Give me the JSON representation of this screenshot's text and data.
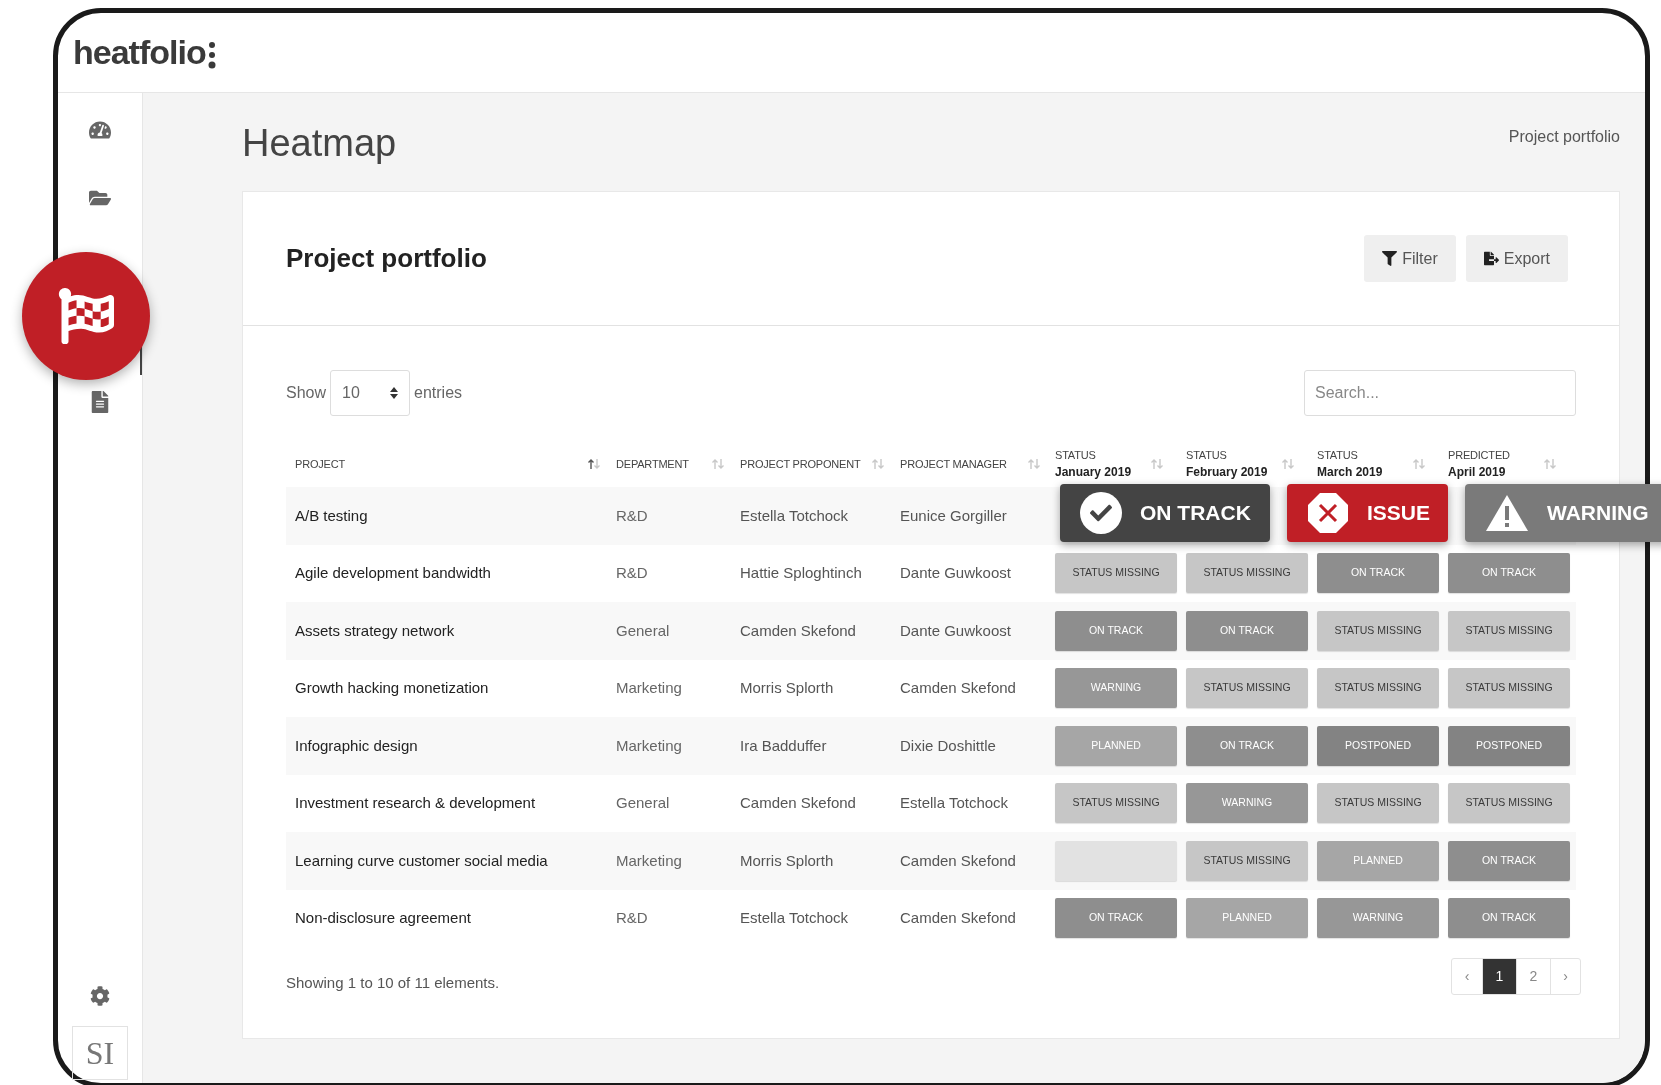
{
  "header": {
    "logo": "heatfolio"
  },
  "sidebar": {
    "items": [
      {
        "kind": "dashboard",
        "selected": false
      },
      {
        "kind": "folder",
        "selected": false
      },
      {
        "kind": "flag",
        "selected": true
      },
      {
        "kind": "document",
        "selected": false
      }
    ],
    "avatar": "SI"
  },
  "page": {
    "title": "Heatmap",
    "breadcrumb": "Project portfolio"
  },
  "card": {
    "title": "Project portfolio",
    "actions": [
      {
        "kind": "filter",
        "label": "Filter"
      },
      {
        "kind": "export",
        "label": "Export"
      }
    ]
  },
  "length_control": {
    "before": "Show",
    "value": "10",
    "after": "entries"
  },
  "search": {
    "placeholder": "Search..."
  },
  "table": {
    "columns": [
      {
        "label": "PROJECT",
        "sorted_ascending": true
      },
      {
        "label": "DEPARTMENT",
        "sorted_ascending": false
      },
      {
        "label": "PROJECT PROPONENT",
        "sorted_ascending": false
      },
      {
        "label": "PROJECT MANAGER",
        "sorted_ascending": false
      },
      {
        "label": "STATUS",
        "sublabel": "January 2019",
        "sorted_ascending": false
      },
      {
        "label": "STATUS",
        "sublabel": "February 2019",
        "sorted_ascending": false
      },
      {
        "label": "STATUS",
        "sublabel": "March 2019",
        "sorted_ascending": false
      },
      {
        "label": "PREDICTED",
        "sublabel": "April 2019",
        "sorted_ascending": false
      }
    ],
    "rows": [
      {
        "project": "A/B testing",
        "department": "R&D",
        "proponent": "Estella Totchock",
        "manager": "Eunice Gorgiller",
        "statuses": []
      },
      {
        "project": "Agile development bandwidth",
        "department": "R&D",
        "proponent": "Hattie Sploghtinch",
        "manager": "Dante Guwkoost",
        "statuses": [
          {
            "kind": "missing",
            "label": "STATUS MISSING"
          },
          {
            "kind": "missing",
            "label": "STATUS MISSING"
          },
          {
            "kind": "on_track",
            "label": "ON TRACK"
          },
          {
            "kind": "on_track",
            "label": "ON TRACK"
          }
        ]
      },
      {
        "project": "Assets strategy network",
        "department": "General",
        "proponent": "Camden Skefond",
        "manager": "Dante Guwkoost",
        "statuses": [
          {
            "kind": "on_track",
            "label": "ON TRACK"
          },
          {
            "kind": "on_track",
            "label": "ON TRACK"
          },
          {
            "kind": "missing",
            "label": "STATUS MISSING"
          },
          {
            "kind": "missing",
            "label": "STATUS MISSING"
          }
        ]
      },
      {
        "project": "Growth hacking monetization",
        "department": "Marketing",
        "proponent": "Morris Splorth",
        "manager": "Camden Skefond",
        "statuses": [
          {
            "kind": "warning",
            "label": "WARNING"
          },
          {
            "kind": "missing",
            "label": "STATUS MISSING"
          },
          {
            "kind": "missing",
            "label": "STATUS MISSING"
          },
          {
            "kind": "missing",
            "label": "STATUS MISSING"
          }
        ]
      },
      {
        "project": "Infographic design",
        "department": "Marketing",
        "proponent": "Ira Badduffer",
        "manager": "Dixie Doshittle",
        "statuses": [
          {
            "kind": "planned",
            "label": "PLANNED"
          },
          {
            "kind": "on_track",
            "label": "ON TRACK"
          },
          {
            "kind": "postponed",
            "label": "POSTPONED"
          },
          {
            "kind": "postponed",
            "label": "POSTPONED"
          }
        ]
      },
      {
        "project": "Investment research & development",
        "department": "General",
        "proponent": "Camden Skefond",
        "manager": "Estella Totchock",
        "statuses": [
          {
            "kind": "missing",
            "label": "STATUS MISSING"
          },
          {
            "kind": "warning",
            "label": "WARNING"
          },
          {
            "kind": "missing",
            "label": "STATUS MISSING"
          },
          {
            "kind": "missing",
            "label": "STATUS MISSING"
          }
        ]
      },
      {
        "project": "Learning curve customer social media",
        "department": "Marketing",
        "proponent": "Morris Splorth",
        "manager": "Camden Skefond",
        "statuses": [
          {
            "kind": "empty"
          },
          {
            "kind": "missing",
            "label": "STATUS MISSING"
          },
          {
            "kind": "planned",
            "label": "PLANNED"
          },
          {
            "kind": "on_track",
            "label": "ON TRACK"
          }
        ]
      },
      {
        "project": "Non-disclosure agreement",
        "department": "R&D",
        "proponent": "Estella Totchock",
        "manager": "Camden Skefond",
        "statuses": [
          {
            "kind": "on_track",
            "label": "ON TRACK"
          },
          {
            "kind": "planned",
            "label": "PLANNED"
          },
          {
            "kind": "warning",
            "label": "WARNING"
          },
          {
            "kind": "on_track",
            "label": "ON TRACK"
          }
        ]
      }
    ]
  },
  "callouts": [
    {
      "kind": "on_track",
      "label": "ON TRACK"
    },
    {
      "kind": "issue",
      "label": "ISSUE"
    },
    {
      "kind": "warning",
      "label": "WARNING"
    }
  ],
  "footer": {
    "info": "Showing 1 to 10 of 11 elements."
  },
  "pagination": [
    {
      "kind": "prev",
      "label": "‹",
      "selected": false
    },
    {
      "kind": "page",
      "label": "1",
      "selected": true
    },
    {
      "kind": "page",
      "label": "2",
      "selected": false
    },
    {
      "kind": "next",
      "label": "›",
      "selected": false
    }
  ]
}
